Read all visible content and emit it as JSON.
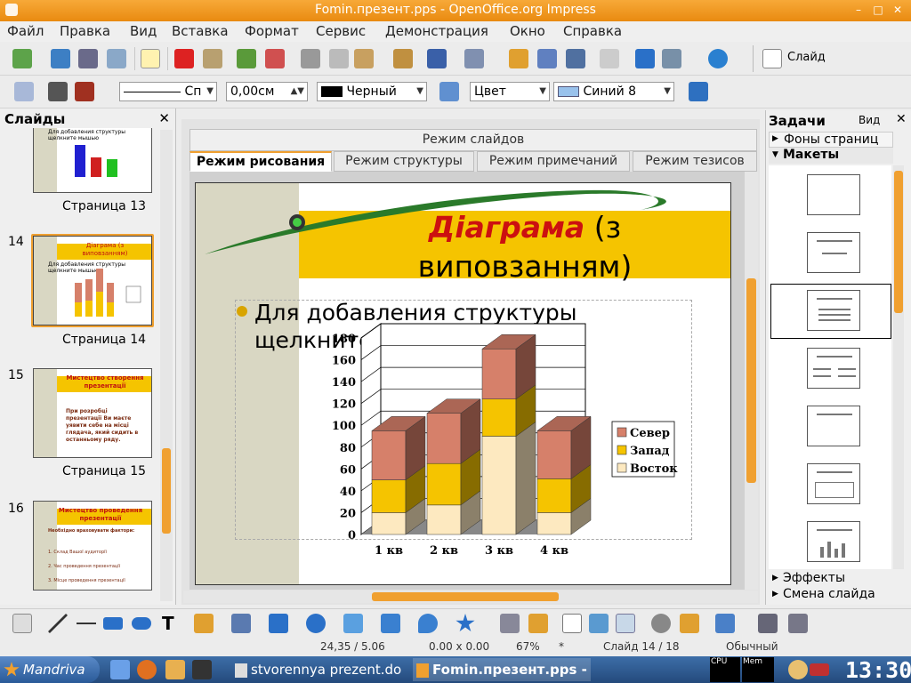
{
  "window": {
    "title": "Fomin.презент.pps - OpenOffice.org Impress",
    "min": "–",
    "max": "□",
    "close": "✕"
  },
  "menu": [
    "Файл",
    "Правка",
    "Вид",
    "Вставка",
    "Формат",
    "Сервис",
    "Демонстрация",
    "Окно",
    "Справка"
  ],
  "toolbar": {
    "slide_button": "Слайд",
    "line_style": "Сп",
    "line_width": "0,00см",
    "line_color": "Черный",
    "area_style": "Цвет",
    "area_color": "Синий 8"
  },
  "slides_panel": {
    "title": "Слайды",
    "close": "✕",
    "items": [
      {
        "number": "",
        "label": "Страница 13",
        "title": "",
        "text": "Для добавления структуры щелкните мышью"
      },
      {
        "number": "14",
        "label": "Страница 14",
        "title": "Діаграма (з виповзанням)",
        "text": "Для добавления структуры щелкните мышью"
      },
      {
        "number": "15",
        "label": "Страница 15",
        "title": "Мистецтво створення презентації",
        "text": "При розробці презентації Ви маєте уявити себе на місці глядача, який сидить в останньому ряду."
      },
      {
        "number": "16",
        "label": "",
        "title": "Мистецтво проведення презентації",
        "text": "Необхідно враховувати фактори:",
        "sub": [
          "1. Склад Вашої аудиторії",
          "2. Час проведення презентації",
          "3. Місце проведення презентації"
        ]
      }
    ]
  },
  "view_modes": {
    "label": "Режим слайдов",
    "tabs": [
      "Режим рисования",
      "Режим структуры",
      "Режим примечаний",
      "Режим тезисов"
    ]
  },
  "slide": {
    "title_bold": "Діаграма",
    "title_rest": " (з",
    "title_line2": "виповзанням)",
    "bullet": "Для добавления структуры щелкните мышью"
  },
  "chart_data": {
    "type": "bar",
    "stacked": true,
    "three_d": true,
    "categories": [
      "1 кв",
      "2 кв",
      "3 кв",
      "4 кв"
    ],
    "series": [
      {
        "name": "Восток",
        "values": [
          20,
          27,
          90,
          20
        ],
        "color": "#fde9c0"
      },
      {
        "name": "Запад",
        "values": [
          30,
          38,
          34,
          31
        ],
        "color": "#f5c400"
      },
      {
        "name": "Север",
        "values": [
          45,
          46,
          46,
          44
        ],
        "color": "#d6806a"
      }
    ],
    "ylim": [
      0,
      180
    ],
    "yticks": [
      "0",
      "20",
      "40",
      "60",
      "80",
      "100",
      "120",
      "140",
      "160",
      "180"
    ],
    "legend": [
      "Север",
      "Запад",
      "Восток"
    ],
    "legend_position": "right",
    "grid": true
  },
  "tasks_panel": {
    "title": "Задачи",
    "view_menu": "Вид",
    "close": "✕",
    "sections": [
      "Фоны страниц",
      "Макеты",
      "Эффекты",
      "Смена слайда"
    ]
  },
  "statusbar": {
    "position": "24,35 / 5.06",
    "size": "0.00 x 0.00",
    "zoom": "67%",
    "modified": "*",
    "slide": "Слайд 14 / 18",
    "layout": "Обычный"
  },
  "taskbar": {
    "start": "Mandriva",
    "task1": "stvorennya prezent.do",
    "task2": "Fomin.презент.pps -",
    "cpu": "CPU",
    "mem": "Mem",
    "clock": "13:30"
  },
  "colors": {
    "accent": "#f0a030",
    "title_red": "#cc1010",
    "title_band": "#f5c400",
    "slide_band": "#d9d7c3"
  }
}
